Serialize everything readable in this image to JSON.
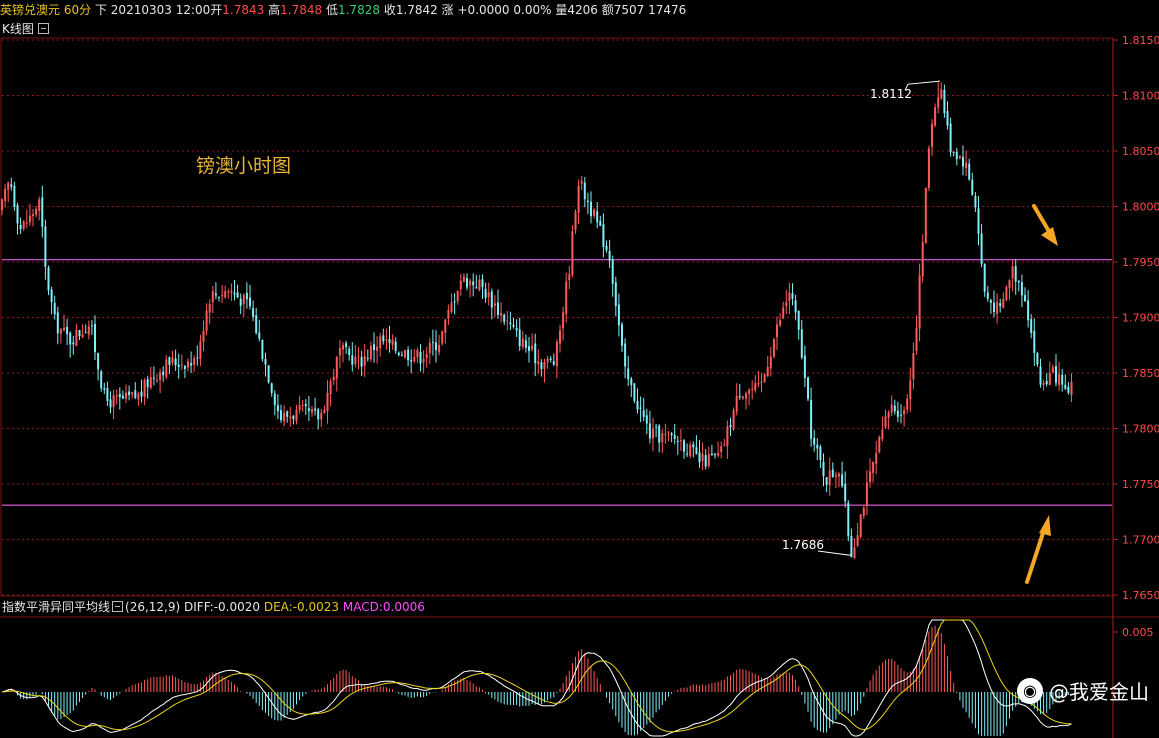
{
  "info_bar": {
    "symbol": "英镑兑澳元",
    "period": "60分",
    "direction": "下",
    "datetime": "20210303 12:00",
    "open_label": "开",
    "open": "1.7843",
    "high_label": "高",
    "high": "1.7848",
    "low_label": "低",
    "low": "1.7828",
    "close_label": "收",
    "close": "1.7842",
    "change_label": "涨",
    "change": "+0.0000",
    "change_pct": "0.00%",
    "volume_label": "量",
    "volume": "4206",
    "amount_label": "额",
    "amount": "7507",
    "extra": "17476"
  },
  "kline_panel": {
    "title": "K线图"
  },
  "annotation": {
    "text": "镑澳小时图"
  },
  "macd_panel": {
    "name": "指数平滑异同平均线",
    "params": "(26,12,9)",
    "diff": "DIFF:-0.0020",
    "dea": "DEA:-0.0023",
    "macd": "MACD:0.0006"
  },
  "watermark": {
    "text": "@我爱金山",
    "icon": "weibo-logo-icon"
  },
  "colors": {
    "background": "#000000",
    "up_candle": "#ff5a5a",
    "down_candle": "#7ff0f8",
    "gridline": "#8a1a1a",
    "level_line": "#ff6bff",
    "arrow": "#f5a623",
    "annotation_text": "#e8b339"
  },
  "chart_data": {
    "type": "candlestick",
    "instrument": "英镑兑澳元",
    "timeframe": "60分",
    "y_axis": {
      "ylim": [
        1.765,
        1.815
      ],
      "ticks": [
        "1.8150",
        "1.8100",
        "1.8050",
        "1.8000",
        "1.7950",
        "1.7900",
        "1.7850",
        "1.7800",
        "1.7750",
        "1.7700",
        "1.7650"
      ]
    },
    "price_path": [
      [
        0,
        1.7995
      ],
      [
        10,
        1.8025
      ],
      [
        20,
        1.798
      ],
      [
        30,
        1.799
      ],
      [
        40,
        1.8005
      ],
      [
        45,
        1.7945
      ],
      [
        55,
        1.7895
      ],
      [
        70,
        1.788
      ],
      [
        90,
        1.7895
      ],
      [
        105,
        1.7825
      ],
      [
        120,
        1.7825
      ],
      [
        140,
        1.783
      ],
      [
        150,
        1.7845
      ],
      [
        170,
        1.786
      ],
      [
        195,
        1.786
      ],
      [
        210,
        1.792
      ],
      [
        230,
        1.7925
      ],
      [
        250,
        1.791
      ],
      [
        265,
        1.786
      ],
      [
        280,
        1.781
      ],
      [
        300,
        1.7815
      ],
      [
        320,
        1.781
      ],
      [
        340,
        1.787
      ],
      [
        360,
        1.786
      ],
      [
        380,
        1.788
      ],
      [
        400,
        1.787
      ],
      [
        420,
        1.7865
      ],
      [
        440,
        1.788
      ],
      [
        460,
        1.7935
      ],
      [
        480,
        1.793
      ],
      [
        500,
        1.7905
      ],
      [
        520,
        1.788
      ],
      [
        540,
        1.786
      ],
      [
        555,
        1.786
      ],
      [
        570,
        1.795
      ],
      [
        578,
        1.8025
      ],
      [
        590,
        1.8
      ],
      [
        610,
        1.7955
      ],
      [
        625,
        1.785
      ],
      [
        650,
        1.7795
      ],
      [
        680,
        1.779
      ],
      [
        700,
        1.777
      ],
      [
        720,
        1.7775
      ],
      [
        740,
        1.7835
      ],
      [
        760,
        1.7835
      ],
      [
        775,
        1.7885
      ],
      [
        790,
        1.7925
      ],
      [
        800,
        1.788
      ],
      [
        812,
        1.779
      ],
      [
        826,
        1.7755
      ],
      [
        840,
        1.7765
      ],
      [
        851,
        1.7686
      ],
      [
        868,
        1.775
      ],
      [
        890,
        1.782
      ],
      [
        905,
        1.7815
      ],
      [
        915,
        1.788
      ],
      [
        922,
        1.796
      ],
      [
        930,
        1.807
      ],
      [
        940,
        1.8112
      ],
      [
        950,
        1.8055
      ],
      [
        965,
        1.804
      ],
      [
        975,
        1.8005
      ],
      [
        985,
        1.792
      ],
      [
        1000,
        1.7905
      ],
      [
        1012,
        1.7945
      ],
      [
        1025,
        1.792
      ],
      [
        1040,
        1.784
      ],
      [
        1055,
        1.785
      ],
      [
        1068,
        1.7825
      ],
      [
        1072,
        1.7842
      ]
    ],
    "annotated_points": [
      {
        "label": "1.8112",
        "value": 1.8112
      },
      {
        "label": "1.7686",
        "value": 1.7686
      }
    ],
    "horizontal_levels": [
      1.7952,
      1.7731
    ],
    "macd": {
      "params": [
        26,
        12,
        9
      ],
      "diff": -0.002,
      "dea": -0.0023,
      "macd": 0.0006,
      "y_ticks": [
        "0.005"
      ]
    }
  }
}
